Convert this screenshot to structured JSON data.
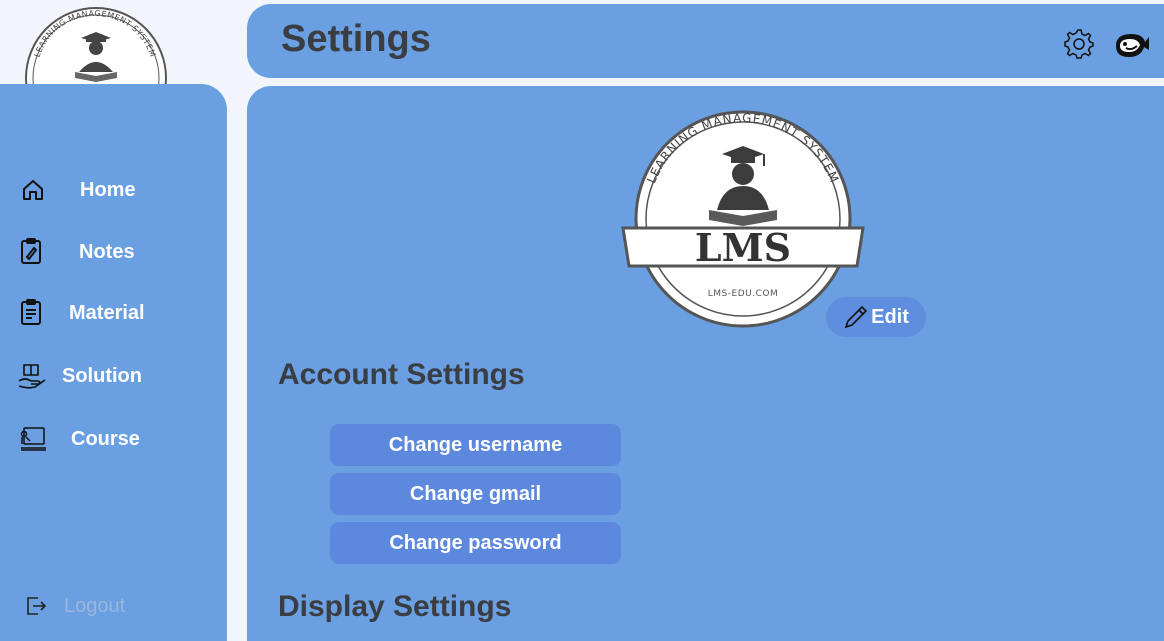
{
  "brand": {
    "logo_text": "LMS",
    "logo_ring_text": "LEARNING MANAGEMENT SYSTEM",
    "logo_url_text": "LMS-EDU.COM"
  },
  "header": {
    "title": "Settings",
    "icons": [
      "gear-icon",
      "whale-icon"
    ]
  },
  "sidebar": {
    "items": [
      {
        "label": "Home",
        "icon": "home-icon"
      },
      {
        "label": "Notes",
        "icon": "notes-icon"
      },
      {
        "label": "Material",
        "icon": "material-icon"
      },
      {
        "label": "Solution",
        "icon": "solution-icon"
      },
      {
        "label": "Course",
        "icon": "course-icon"
      }
    ],
    "logout_label": "Logout"
  },
  "main": {
    "edit_label": "Edit",
    "account_settings_title": "Account Settings",
    "account_actions": [
      {
        "label": "Change username"
      },
      {
        "label": "Change gmail"
      },
      {
        "label": "Change password"
      }
    ],
    "display_settings_title": "Display Settings"
  },
  "colors": {
    "panel": "#6a9fe2",
    "background": "#f2f6fc",
    "button": "#5c88de",
    "title_text": "#3a3d42",
    "logout_text": "#9bb6dc"
  }
}
